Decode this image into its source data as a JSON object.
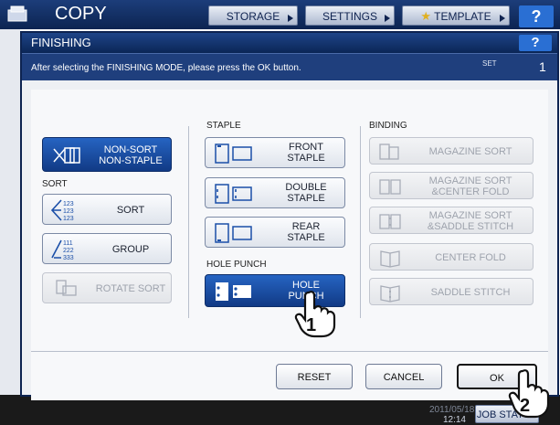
{
  "outer": {
    "title": "COPY",
    "tabs": [
      "STORAGE",
      "SETTINGS",
      "TEMPLATE"
    ],
    "help": "?",
    "clock_date": "2011/05/18",
    "clock_time": "12:14",
    "job_status": "JOB STATUS"
  },
  "dialog": {
    "title": "FINISHING",
    "help": "?",
    "message": "After selecting the FINISHING MODE, please press the OK button.",
    "set_label": "SET",
    "set_count": "1"
  },
  "sections": {
    "sort": "SORT",
    "staple": "STAPLE",
    "hole_punch": "HOLE PUNCH",
    "binding": "BINDING"
  },
  "buttons": {
    "nonsort_1": "NON-SORT",
    "nonsort_2": "NON-STAPLE",
    "sort": "SORT",
    "group": "GROUP",
    "rotate_sort": "ROTATE SORT",
    "front_staple_1": "FRONT",
    "front_staple_2": "STAPLE",
    "double_staple_1": "DOUBLE",
    "double_staple_2": "STAPLE",
    "rear_staple_1": "REAR",
    "rear_staple_2": "STAPLE",
    "hole_punch_1": "HOLE",
    "hole_punch_2": "PUNCH",
    "magazine_sort": "MAGAZINE SORT",
    "mag_center_1": "MAGAZINE SORT",
    "mag_center_2": "&CENTER FOLD",
    "mag_saddle_1": "MAGAZINE SORT",
    "mag_saddle_2": "&SADDLE STITCH",
    "center_fold": "CENTER FOLD",
    "saddle_stitch": "SADDLE STITCH",
    "reset": "RESET",
    "cancel": "CANCEL",
    "ok": "OK"
  },
  "icon_text": {
    "sort_seq": "123",
    "group_seq_1": "111",
    "group_seq_2": "222",
    "group_seq_3": "333"
  },
  "step_markers": [
    "1",
    "2"
  ],
  "colors": {
    "selected": "#1a4ea3",
    "titlebar": "#0b2656",
    "disabled_text": "#9ea3ad"
  }
}
